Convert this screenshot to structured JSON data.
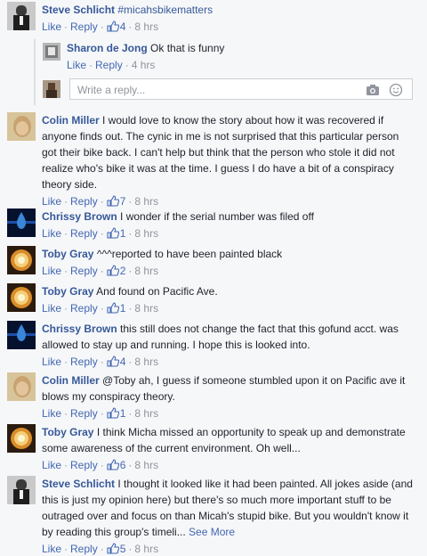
{
  "actions": {
    "like": "Like",
    "reply": "Reply",
    "separator": "·"
  },
  "comments": [
    {
      "author": "Steve Schlicht",
      "text": "#micahsbikematters",
      "likes": "4",
      "time": "8 hrs",
      "avatar": "avatar-steve"
    },
    {
      "author": "Colin Miller",
      "text": "I would love to know the story about how it was recovered if anyone finds out. The cynic in me is not surprised that this particular person got their bike back. I can't help but think that the person who stole it did not realize who's bike it was at the time. I guess I do have a bit of a conspiracy theory side.",
      "likes": "7",
      "time": "8 hrs",
      "avatar": "avatar-colin"
    },
    {
      "author": "Chrissy Brown",
      "text": "I wonder if the serial number was filed off",
      "likes": "1",
      "time": "8 hrs",
      "avatar": "avatar-chrissy"
    },
    {
      "author": "Toby Gray",
      "text": "^^^reported to have been painted black",
      "likes": "2",
      "time": "8 hrs",
      "avatar": "avatar-toby"
    },
    {
      "author": "Toby Gray",
      "text": "And found on Pacific Ave.",
      "likes": "1",
      "time": "8 hrs",
      "avatar": "avatar-toby"
    },
    {
      "author": "Chrissy Brown",
      "text": "this still does not change the fact that this gofund acct. was allowed to stay up and running. I hope this is looked into.",
      "likes": "4",
      "time": "8 hrs",
      "avatar": "avatar-chrissy"
    },
    {
      "author": "Colin Miller",
      "text": "@Toby ah, I guess if someone stumbled upon it on Pacific ave it blows my conspiracy theory.",
      "likes": "1",
      "time": "8 hrs",
      "avatar": "avatar-colin"
    },
    {
      "author": "Toby Gray",
      "text": "I think Micha missed an opportunity to speak up and demonstrate some awareness of the current environment. Oh well...",
      "likes": "6",
      "time": "8 hrs",
      "avatar": "avatar-toby"
    },
    {
      "author": "Steve Schlicht",
      "text": "I thought it looked like it had been painted. All jokes aside (and this is just my opinion here) but there's so much more important stuff to be outraged over and focus on than Micah's stupid bike. But you wouldn't know it by reading this group's timeli...",
      "see_more": "See More",
      "likes": "5",
      "time": "8 hrs",
      "avatar": "avatar-steve"
    }
  ],
  "reply": {
    "author": "Sharon de Jong",
    "text": "Ok that is funny",
    "time": "4 hrs"
  },
  "write_reply": {
    "placeholder": "Write a reply..."
  },
  "colors": {
    "link": "#365899",
    "meta": "#90949c",
    "background": "#f6f7f9"
  }
}
